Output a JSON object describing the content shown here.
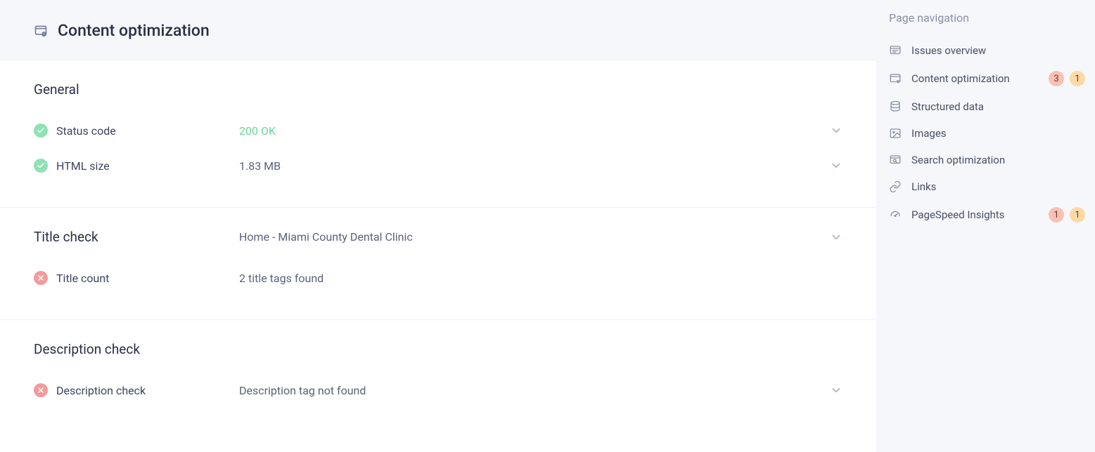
{
  "header": {
    "title": "Content optimization"
  },
  "sections": {
    "general": {
      "heading": "General",
      "status_code": {
        "label": "Status code",
        "value": "200 OK"
      },
      "html_size": {
        "label": "HTML size",
        "value": "1.83 MB"
      }
    },
    "title_check": {
      "heading": "Title check",
      "preview": "Home - Miami County Dental Clinic",
      "title_count": {
        "label": "Title count",
        "value": "2 title tags found"
      }
    },
    "description_check": {
      "heading": "Description check",
      "item": {
        "label": "Description check",
        "value": "Description tag not found"
      }
    }
  },
  "nav": {
    "title": "Page navigation",
    "items": [
      {
        "id": "issues-overview",
        "label": "Issues overview"
      },
      {
        "id": "content-optimization",
        "label": "Content optimization",
        "badge_red": "3",
        "badge_yellow": "1"
      },
      {
        "id": "structured-data",
        "label": "Structured data"
      },
      {
        "id": "images",
        "label": "Images"
      },
      {
        "id": "search-optimization",
        "label": "Search optimization"
      },
      {
        "id": "links",
        "label": "Links"
      },
      {
        "id": "pagespeed-insights",
        "label": "PageSpeed Insights",
        "badge_red": "1",
        "badge_yellow": "1"
      }
    ]
  }
}
